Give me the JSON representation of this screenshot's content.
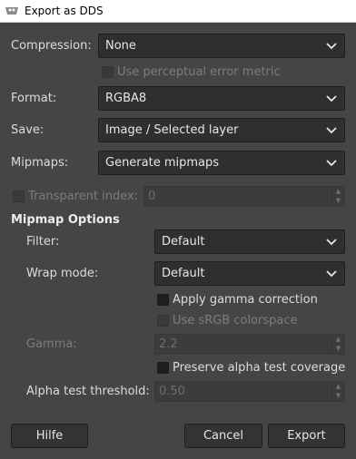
{
  "window": {
    "title": "Export as DDS"
  },
  "fields": {
    "compression": {
      "label": "Compression:",
      "value": "None"
    },
    "perceptual": {
      "label": "Use perceptual error metric"
    },
    "format": {
      "label": "Format:",
      "value": "RGBA8"
    },
    "save": {
      "label": "Save:",
      "value": "Image / Selected layer"
    },
    "mipmaps": {
      "label": "Mipmaps:",
      "value": "Generate mipmaps"
    },
    "transparent": {
      "label": "Transparent index:",
      "value": "0"
    }
  },
  "mipmap_options": {
    "heading": "Mipmap Options",
    "filter": {
      "label": "Filter:",
      "value": "Default"
    },
    "wrap": {
      "label": "Wrap mode:",
      "value": "Default"
    },
    "gamma_correction": {
      "label": "Apply gamma correction"
    },
    "srgb": {
      "label": "Use sRGB colorspace"
    },
    "gamma": {
      "label": "Gamma:",
      "value": "2.2"
    },
    "preserve_alpha": {
      "label": "Preserve alpha test coverage"
    },
    "alpha_threshold": {
      "label": "Alpha test threshold:",
      "value": "0.50"
    }
  },
  "buttons": {
    "help": "Hilfe",
    "cancel": "Cancel",
    "export": "Export"
  },
  "icons": {
    "app": "gimp-icon",
    "dropdown": "chevron-down-icon",
    "spin_up": "triangle-up-icon",
    "spin_down": "triangle-down-icon"
  },
  "colors": {
    "background": "#454545",
    "combo": "#2f2f2f",
    "titlebar": "#ffffff"
  }
}
